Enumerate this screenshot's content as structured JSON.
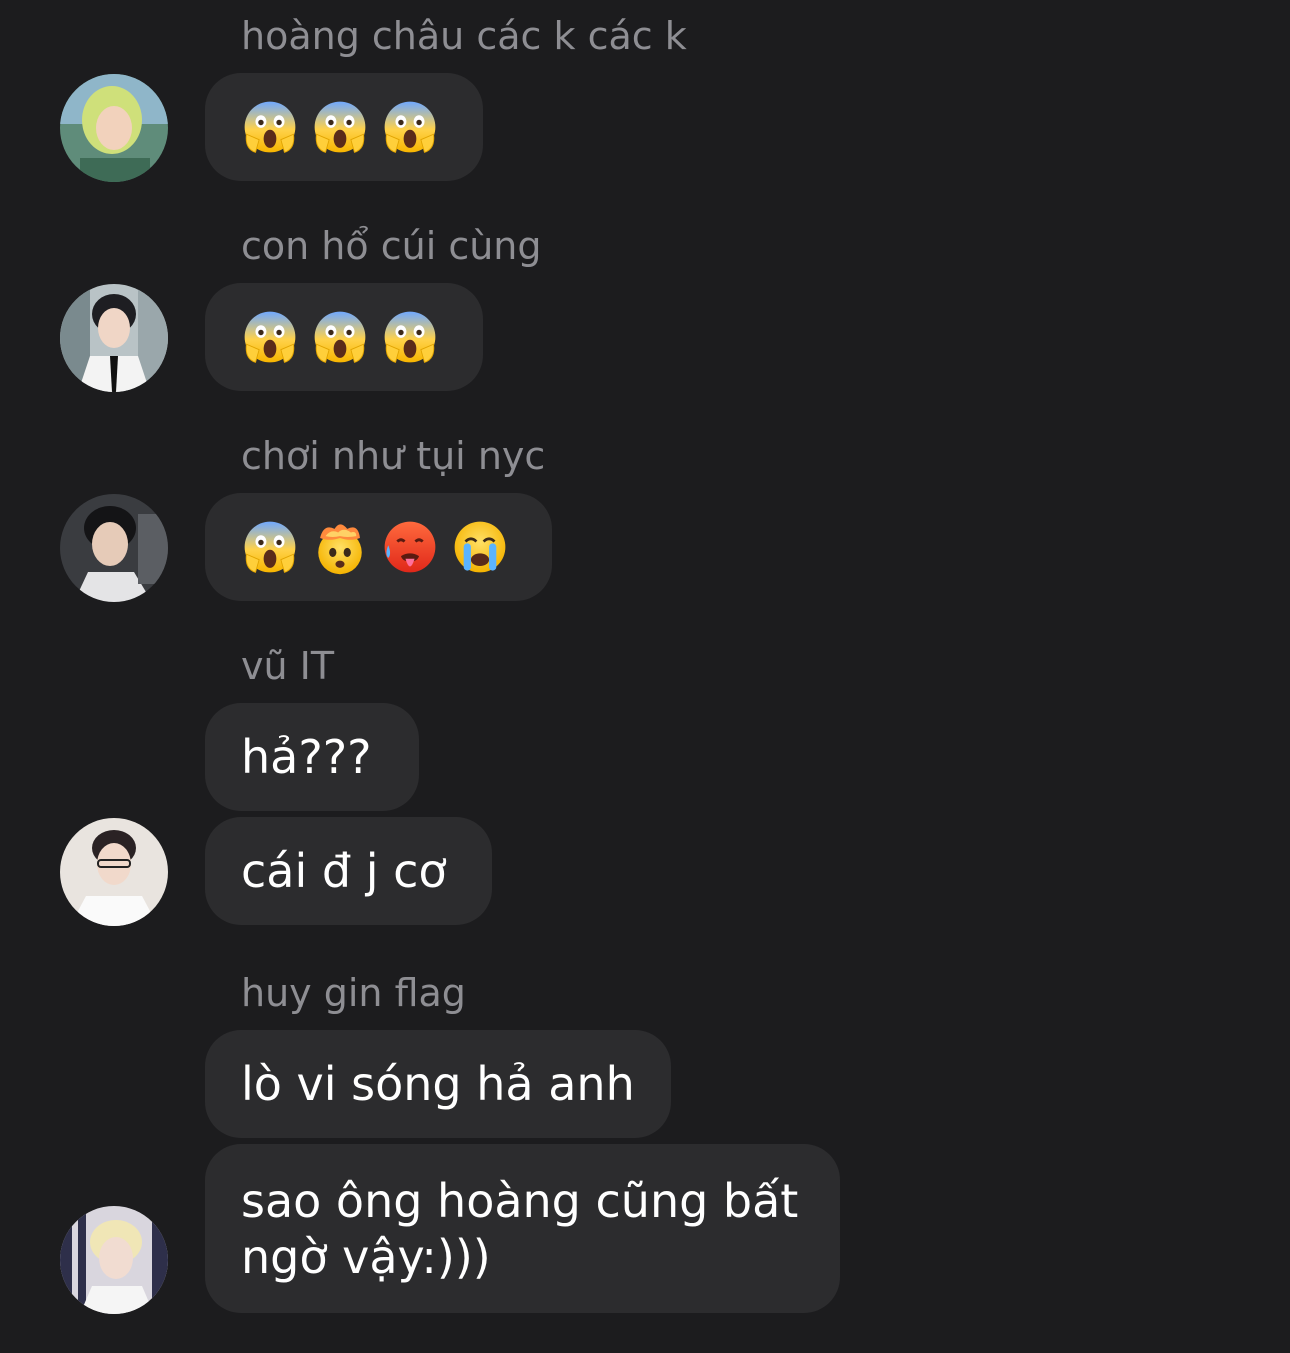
{
  "messages": [
    {
      "sender": "hoàng châu các k các k",
      "emojis": [
        "face-screaming-in-fear",
        "face-screaming-in-fear",
        "face-screaming-in-fear"
      ]
    },
    {
      "sender": "con hổ cúi cùng",
      "emojis": [
        "face-screaming-in-fear",
        "face-screaming-in-fear",
        "face-screaming-in-fear"
      ]
    },
    {
      "sender": "chơi như tụi nyc",
      "emojis": [
        "face-screaming-in-fear",
        "exploding-head",
        "hot-face",
        "loudly-crying-face"
      ]
    },
    {
      "sender": "vũ IT",
      "texts": [
        "hả???",
        "cái đ j cơ"
      ]
    },
    {
      "sender": "huy gin flag",
      "texts": [
        "lò vi sóng hả anh",
        "sao ông hoàng cũng bất ngờ vậy:)))"
      ]
    }
  ],
  "colors": {
    "background": "#1c1c1e",
    "bubble": "#2c2c2e",
    "sender_text": "#8e8e93",
    "message_text": "#ffffff"
  }
}
